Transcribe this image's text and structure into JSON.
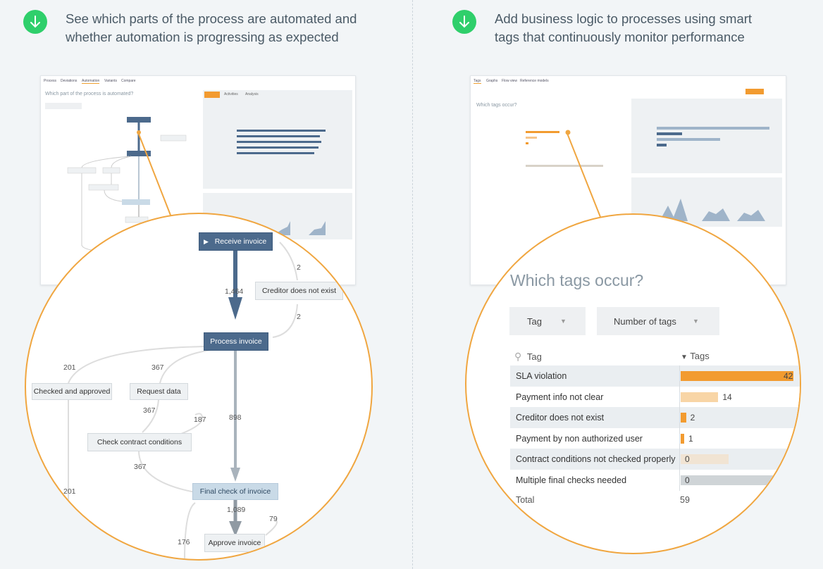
{
  "left_feature": {
    "icon": "arrow-down-icon",
    "line1": "See which parts of the process are automated and",
    "line2": "whether automation is progressing as expected"
  },
  "right_feature": {
    "icon": "arrow-down-icon",
    "line1": "Add business logic to processes using smart",
    "line2": "tags that continuously monitor performance"
  },
  "colors": {
    "accent": "#f0a640",
    "badge": "#2fcf6b",
    "node_dark": "#4c6a8c",
    "node_light": "#c9dae7",
    "bar": "#f29b30"
  },
  "left_thumb": {
    "tabs": [
      "Process",
      "Deviations",
      "Automation",
      "Variants",
      "Compare"
    ],
    "question": "Which part of the process is automated?",
    "mini_tabs": [
      "Activities",
      "Analysis"
    ]
  },
  "right_thumb": {
    "tabs": [
      "Tags",
      "Graphs",
      "Flow view",
      "Reference models"
    ],
    "question": "Which tags occur?"
  },
  "process_zoom": {
    "nodes": {
      "receive_invoice": "Receive invoice",
      "creditor_not_exist": "Creditor does not exist",
      "process_invoice": "Process invoice",
      "checked_approved": "Checked and approved",
      "request_data": "Request data",
      "check_contract": "Check contract conditions",
      "final_check": "Final check of invoice",
      "approve_invoice": "Approve invoice"
    },
    "edges": {
      "e1464": "1,464",
      "e2a": "2",
      "e2b": "2",
      "e201a": "201",
      "e367a": "367",
      "e367b": "367",
      "e187": "187",
      "e898": "898",
      "e367c": "367",
      "e201b": "201",
      "e1089": "1,089",
      "e79": "79",
      "e176": "176"
    }
  },
  "tags_zoom": {
    "title": "Which tags occur?",
    "dropdown1": "Tag",
    "dropdown2": "Number of tags",
    "col_tag": "Tag",
    "col_tags": "Tags",
    "rows": [
      {
        "label": "SLA violation",
        "value": "42",
        "count": 42
      },
      {
        "label": "Payment info not clear",
        "value": "14",
        "count": 14
      },
      {
        "label": "Creditor does not exist",
        "value": "2",
        "count": 2
      },
      {
        "label": "Payment by non authorized user",
        "value": "1",
        "count": 1
      },
      {
        "label": "Contract conditions not checked properly",
        "value": "0",
        "count": 0
      },
      {
        "label": "Multiple final checks needed",
        "value": "0",
        "count": 0
      }
    ],
    "total_label": "Total",
    "total_value": "59"
  }
}
